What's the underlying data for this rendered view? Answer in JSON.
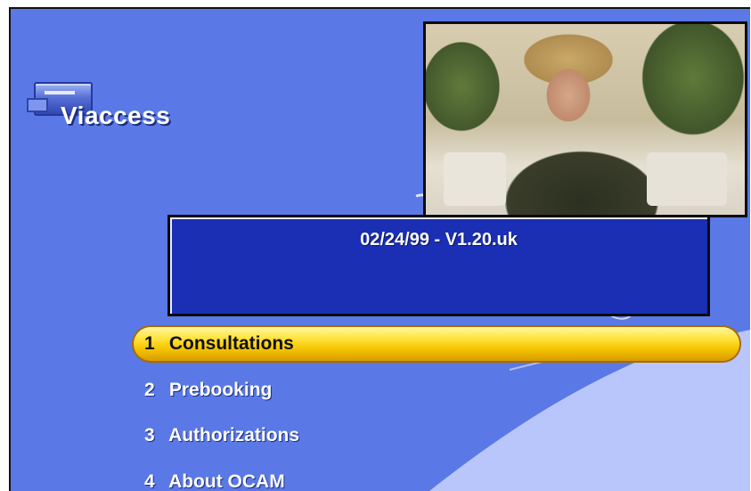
{
  "logo": {
    "text": "Viaccess",
    "icon": "viaccess-logo-icon"
  },
  "video": {
    "icon": "video-preview"
  },
  "info": {
    "text": "02/24/99 - V1.20.uk"
  },
  "menu": {
    "items": [
      {
        "number": "1",
        "label": "Consultations",
        "selected": true
      },
      {
        "number": "2",
        "label": "Prebooking",
        "selected": false
      },
      {
        "number": "3",
        "label": "Authorizations",
        "selected": false
      },
      {
        "number": "4",
        "label": "About OCAM",
        "selected": false
      }
    ]
  },
  "colors": {
    "background": "#5a79e6",
    "info_box": "#1a2fb4",
    "highlight": "#ffd800"
  }
}
